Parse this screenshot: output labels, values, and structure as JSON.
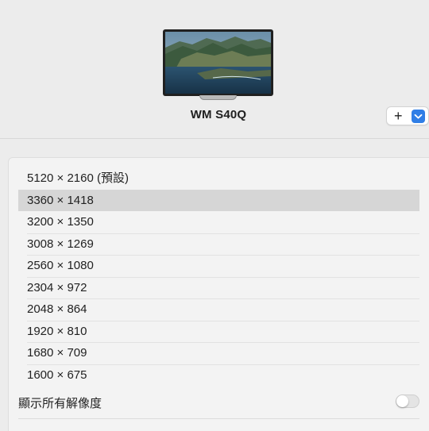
{
  "display": {
    "name": "WM S40Q"
  },
  "controls": {
    "add_symbol": "+",
    "menu_icon": "chevron-down-icon",
    "accent_color": "#2f7ee6"
  },
  "resolutions": {
    "items": [
      {
        "label": "5120 × 2160 (預設)",
        "selected": false
      },
      {
        "label": "3360 × 1418",
        "selected": true
      },
      {
        "label": "3200 × 1350",
        "selected": false
      },
      {
        "label": "3008 × 1269",
        "selected": false
      },
      {
        "label": "2560 × 1080",
        "selected": false
      },
      {
        "label": "2304 × 972",
        "selected": false
      },
      {
        "label": "2048 × 864",
        "selected": false
      },
      {
        "label": "1920 × 810",
        "selected": false
      },
      {
        "label": "1680 × 709",
        "selected": false
      },
      {
        "label": "1600 × 675",
        "selected": false
      }
    ],
    "show_all_label": "顯示所有解像度",
    "show_all_enabled": false
  }
}
